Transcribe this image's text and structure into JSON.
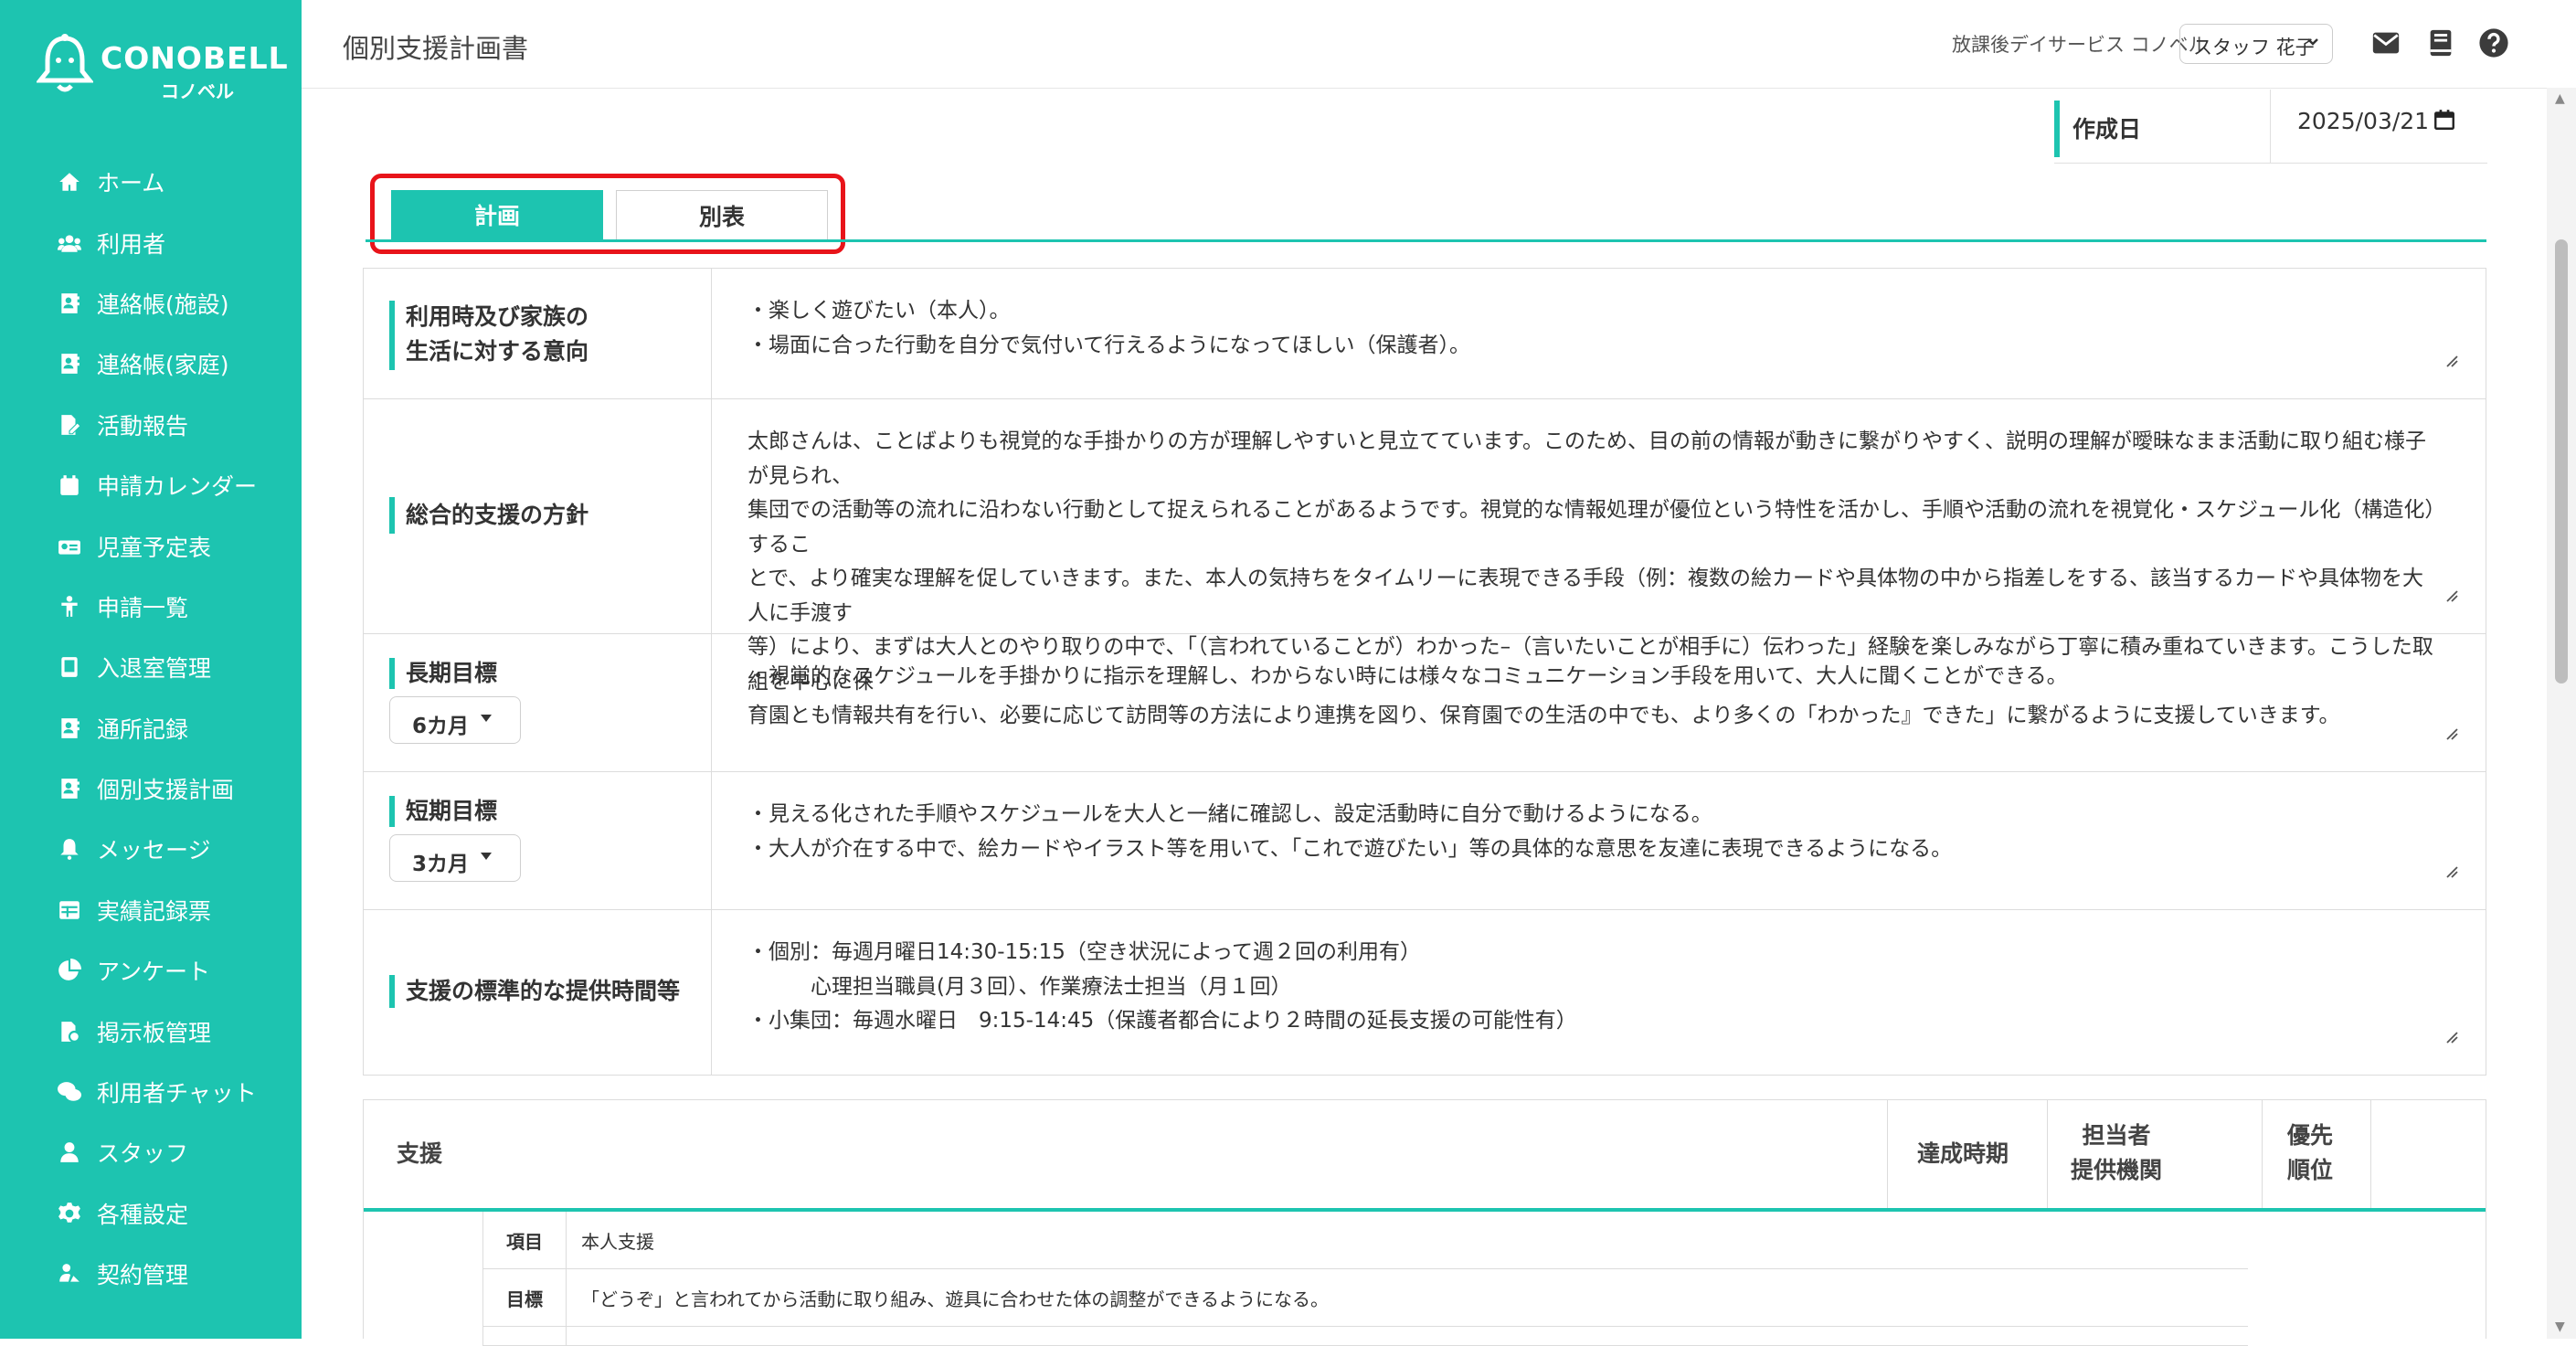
{
  "brand": {
    "name": "CONOBELL",
    "sub": "コノベル"
  },
  "sidebar": {
    "items": [
      {
        "label": "ホーム",
        "icon": "home-icon"
      },
      {
        "label": "利用者",
        "icon": "users-icon"
      },
      {
        "label": "連絡帳(施設)",
        "icon": "contact-book-icon"
      },
      {
        "label": "連絡帳(家庭)",
        "icon": "contact-book-icon"
      },
      {
        "label": "活動報告",
        "icon": "report-edit-icon"
      },
      {
        "label": "申請カレンダー",
        "icon": "calendar-icon"
      },
      {
        "label": "児童予定表",
        "icon": "schedule-icon"
      },
      {
        "label": "申請一覧",
        "icon": "child-icon"
      },
      {
        "label": "入退室管理",
        "icon": "tablet-icon"
      },
      {
        "label": "通所記録",
        "icon": "contact-book-icon"
      },
      {
        "label": "個別支援計画",
        "icon": "contact-book-icon"
      },
      {
        "label": "メッセージ",
        "icon": "bell-icon"
      },
      {
        "label": "実績記録票",
        "icon": "table-icon"
      },
      {
        "label": "アンケート",
        "icon": "pie-chart-icon"
      },
      {
        "label": "掲示板管理",
        "icon": "board-icon"
      },
      {
        "label": "利用者チャット",
        "icon": "chat-icon"
      },
      {
        "label": "スタッフ",
        "icon": "staff-icon"
      },
      {
        "label": "各種設定",
        "icon": "gear-icon"
      },
      {
        "label": "契約管理",
        "icon": "contract-icon"
      }
    ]
  },
  "header": {
    "title": "個別支援計画書",
    "facility": "放課後デイサービス コノベル",
    "staff": "スタッフ 花子"
  },
  "created": {
    "label": "作成日",
    "value": "2025/03/21"
  },
  "tabs": {
    "plan": "計画",
    "appendix": "別表"
  },
  "plan": {
    "intent": {
      "label_line1": "利用時及び家族の",
      "label_line2": "生活に対する意向",
      "lines": [
        "・楽しく遊びたい（本人）。",
        "・場面に合った行動を自分で気付いて行えるようになってほしい（保護者）。"
      ]
    },
    "policy": {
      "label": "総合的支援の方針",
      "lines": [
        "太郎さんは、ことばよりも視覚的な手掛かりの方が理解しやすいと見立てています。このため、目の前の情報が動きに繋がりやすく、説明の理解が曖昧なまま活動に取り組む様子が見られ、",
        "集団での活動等の流れに沿わない行動として捉えられることがあるようです。視覚的な情報処理が優位という特性を活かし、手順や活動の流れを視覚化・スケジュール化（構造化）するこ",
        "とで、より確実な理解を促していきます。また、本人の気持ちをタイムリーに表現できる手段（例：複数の絵カードや具体物の中から指差しをする、該当するカードや具体物を大人に手渡す",
        "等）により、まずは大人とのやり取りの中で、「（言われていることが）わかった–（言いたいことが相手に）伝わった」経験を楽しみながら丁寧に積み重ねていきます。こうした取組を中心に保",
        "育園とも情報共有を行い、必要に応じて訪問等の方法により連携を図り、保育園での生活の中でも、より多くの「わかった』できた」に繋がるように支援していきます。"
      ]
    },
    "long_goal": {
      "label": "長期目標",
      "period": "6カ月",
      "lines": [
        "・視覚的なスケジュールを手掛かりに指示を理解し、わからない時には様々なコミュニケーション手段を用いて、大人に聞くことができる。"
      ]
    },
    "short_goal": {
      "label": "短期目標",
      "period": "3カ月",
      "lines": [
        "・見える化された手順やスケジュールを大人と一緒に確認し、設定活動時に自分で動けるようになる。",
        "・大人が介在する中で、絵カードやイラスト等を用いて、「これで遊びたい」等の具体的な意思を友達に表現できるようになる。"
      ]
    },
    "hours": {
      "label": "支援の標準的な提供時間等",
      "lines": [
        "・個別：毎週月曜日14:30-15:15（空き状況によって週２回の利用有）",
        "　　　心理担当職員(月３回）、作業療法士担当（月１回）",
        "・小集団：毎週水曜日　9:15-14:45（保護者都合により２時間の延長支援の可能性有）"
      ]
    }
  },
  "support": {
    "header": {
      "support": "支援",
      "achieve": "達成時期",
      "staff_line1": "担当者",
      "staff_line2": "提供機関",
      "priority_line1": "優先",
      "priority_line2": "順位"
    },
    "rows": [
      {
        "key": "項目",
        "value": "本人支援"
      },
      {
        "key": "目標",
        "value": "「どうぞ」と言われてから活動に取り組み、遊具に合わせた体の調整ができるようになる。"
      }
    ]
  },
  "colors": {
    "accent": "#1dc4b0",
    "highlight": "#e8141a"
  }
}
